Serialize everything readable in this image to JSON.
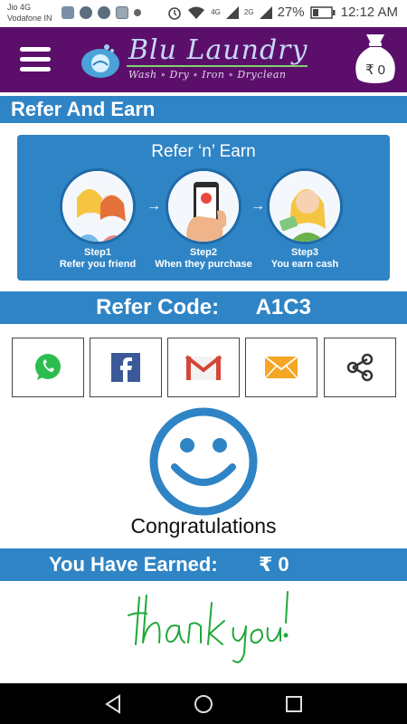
{
  "status_bar": {
    "carrier_1": "Jio 4G",
    "carrier_2": "Vodafone IN",
    "net_1": "4G",
    "net_2": "2G",
    "battery": "27%",
    "time": "12:12 AM"
  },
  "header": {
    "brand_name": "Blu Laundry",
    "tagline": "Wash ∘ Dry ∘ Iron ∘ Dryclean",
    "wallet_amount": "₹ 0"
  },
  "page": {
    "section_title": "Refer And Earn",
    "card_title": "Refer ‘n’ Earn",
    "steps": [
      {
        "title": "Step1",
        "desc": "Refer you friend"
      },
      {
        "title": "Step2",
        "desc": "When they purchase"
      },
      {
        "title": "Step3",
        "desc": "You earn cash"
      }
    ],
    "refer_code_label": "Refer Code:",
    "refer_code": "A1C3",
    "share_buttons": [
      "whatsapp-icon",
      "facebook-icon",
      "gmail-icon",
      "email-icon",
      "share-icon"
    ],
    "congratulations": "Congratulations",
    "earned_label": "You Have Earned:",
    "earned_value": "₹  0"
  },
  "colors": {
    "header_purple": "#5b0f6b",
    "accent_blue": "#2f84c5",
    "whatsapp_green": "#2dbd4e",
    "facebook_blue": "#3b5998",
    "gmail_red": "#d44638",
    "email_orange": "#f5a623",
    "thank_you_green": "#1fa83a"
  }
}
